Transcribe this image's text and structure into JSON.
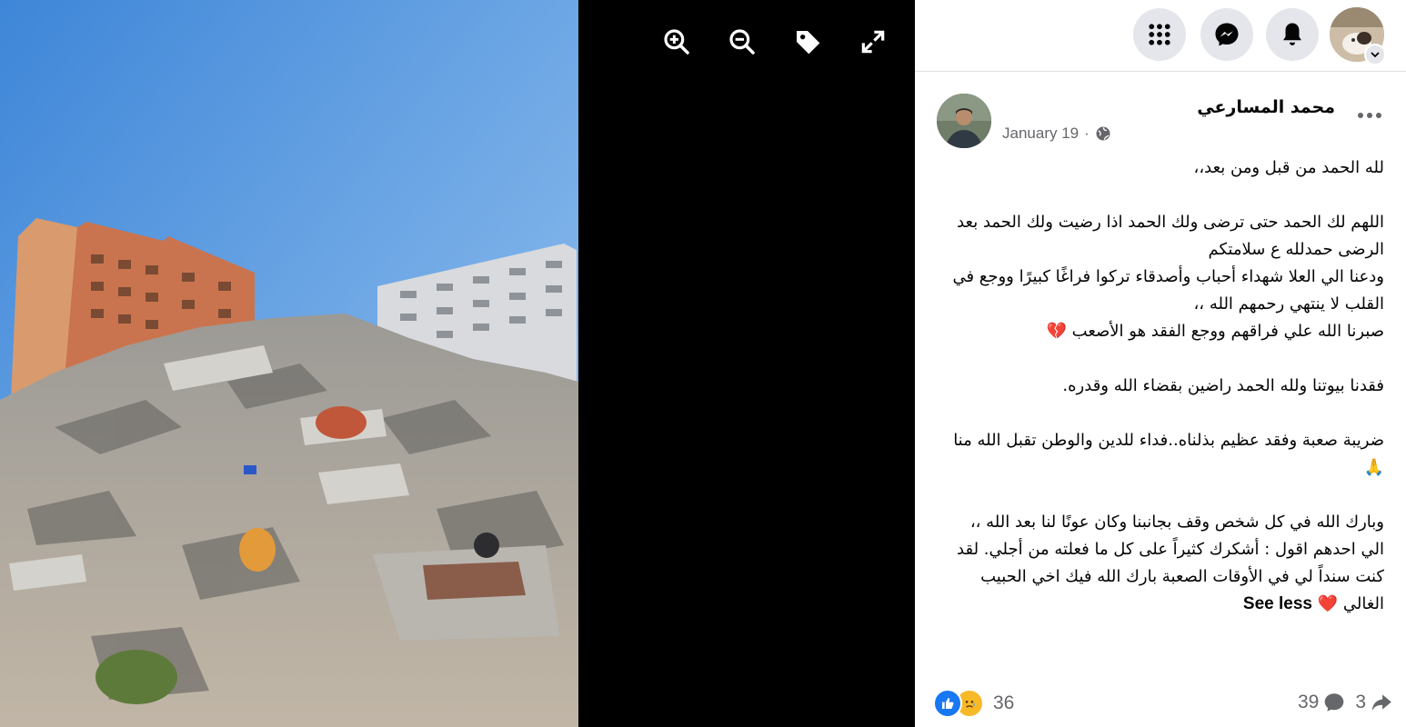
{
  "viewer": {
    "photo_alt": "",
    "tools": [
      {
        "name": "zoom-in-icon"
      },
      {
        "name": "zoom-out-icon"
      },
      {
        "name": "tag-icon"
      },
      {
        "name": "fullscreen-icon"
      }
    ]
  },
  "topbar": {
    "icons": [
      "menu-grid-icon",
      "messenger-icon",
      "notifications-icon"
    ],
    "account_icon": "chevron-down-icon"
  },
  "post": {
    "author": "محمد المسارعي",
    "date": "January 19",
    "date_separator": "·",
    "privacy_icon": "globe-icon",
    "lines": [
      "لله الحمد من قبل ومن بعد،،",
      "",
      "اللهم لك الحمد حتى ترضى ولك الحمد اذا رضيت ولك الحمد بعد الرضى حمدلله ع سلامتكم",
      "ودعنا الي العلا شهداء أحباب وأصدقاء تركوا فراغًا كبيرًا ووجع في القلب لا ينتهي رحمهم الله ،،",
      "صبرنا الله علي فراقهم ووجع الفقد هو الأصعب 💔",
      "",
      "فقدنا بيوتنا ولله الحمد راضين بقضاء الله وقدره.",
      "",
      "ضريبة صعبة وفقد عظيم بذلناه..فداء للدين والوطن تقبل الله منا 🙏",
      "",
      "وبارك الله في كل شخص وقف بجانبنا وكان عونًا لنا بعد الله ،،",
      "الي احدهم اقول : أشكرك كثيراً على كل ما فعلته من أجلي. لقد كنت سنداً لي في الأوقات الصعبة بارك الله فيك اخي الحبيب الغالي ❤️"
    ],
    "see_less": "See less",
    "reaction_count": "36",
    "comment_count": "39",
    "share_count": "3"
  },
  "colors": {
    "panel_bg": "#ffffff",
    "icon_circle": "#e4e6eb",
    "like_blue": "#1877f2",
    "care_yellow": "#f7b928",
    "meta_gray": "#65676b"
  }
}
